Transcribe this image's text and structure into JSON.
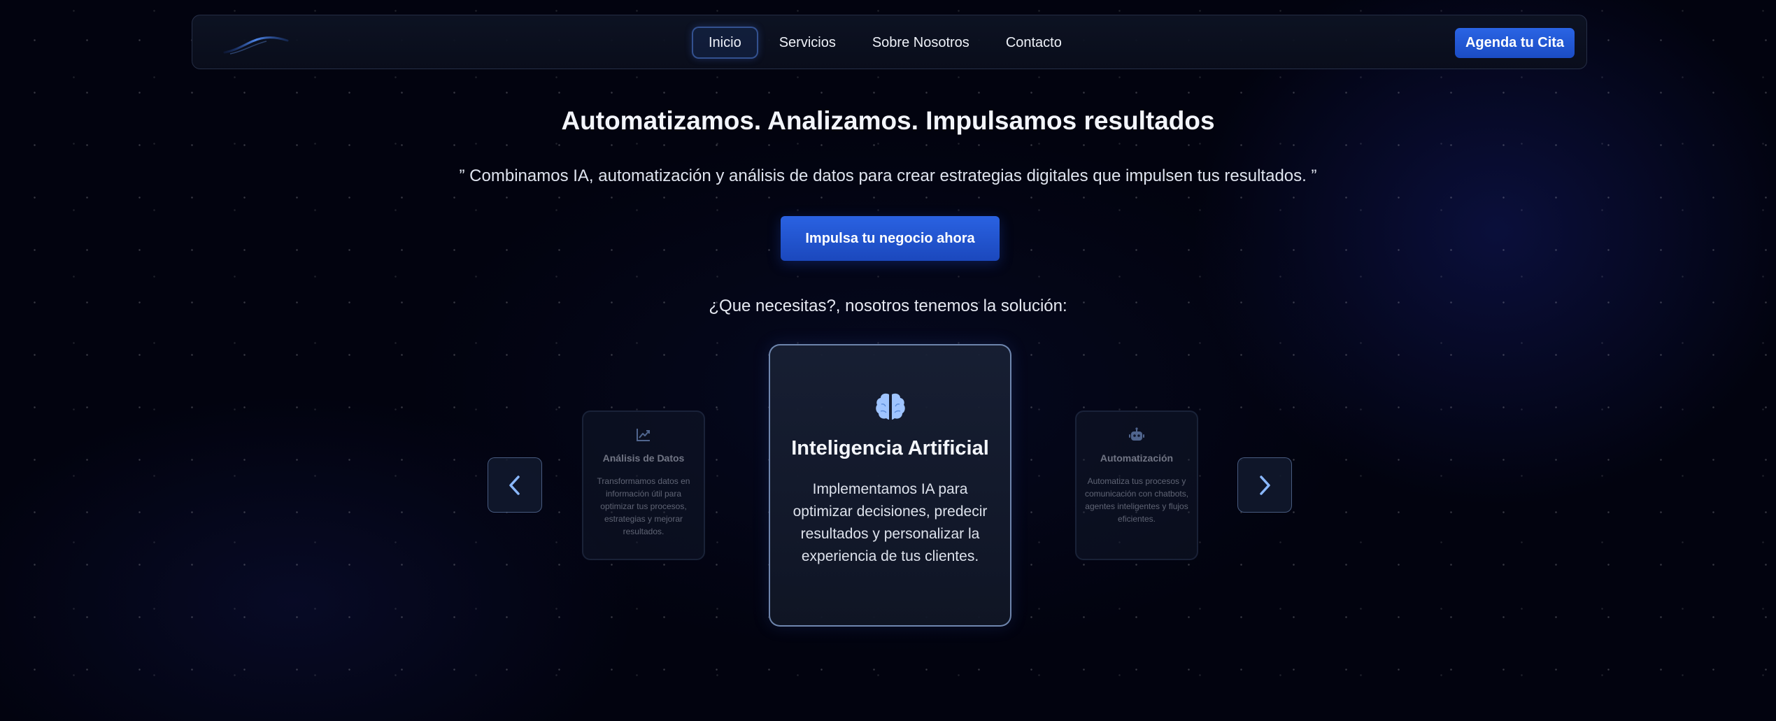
{
  "nav": {
    "links": [
      "Inicio",
      "Servicios",
      "Sobre Nosotros",
      "Contacto"
    ],
    "active_index": 0,
    "cta_label": "Agenda tu Cita"
  },
  "hero": {
    "title": "Automatizamos. Analizamos. Impulsamos resultados",
    "subtitle": "” Combinamos IA, automatización y análisis de datos para crear estrategias digitales que impulsen tus resultados. ”",
    "cta_label": "Impulsa tu negocio ahora",
    "question": "¿Que necesitas?, nosotros tenemos la solución:"
  },
  "carousel": {
    "cards": [
      {
        "icon": "chart-line-icon",
        "title": "Análisis de Datos",
        "description": "Transformamos datos en información útil para optimizar tus procesos, estrategias y mejorar resultados."
      },
      {
        "icon": "brain-icon",
        "title": "Inteligencia Artificial",
        "description": "Implementamos IA para optimizar decisiones, predecir resultados y personalizar la experiencia de tus clientes."
      },
      {
        "icon": "robot-icon",
        "title": "Automatización",
        "description": "Automatiza tus procesos y comunicación con chatbots, agentes inteligentes y flujos eficientes."
      }
    ],
    "active_index": 1
  },
  "colors": {
    "background": "#02030f",
    "accent": "#2a64e4",
    "icon": "#9fc4ff",
    "arrow": "#8ab8ff"
  }
}
